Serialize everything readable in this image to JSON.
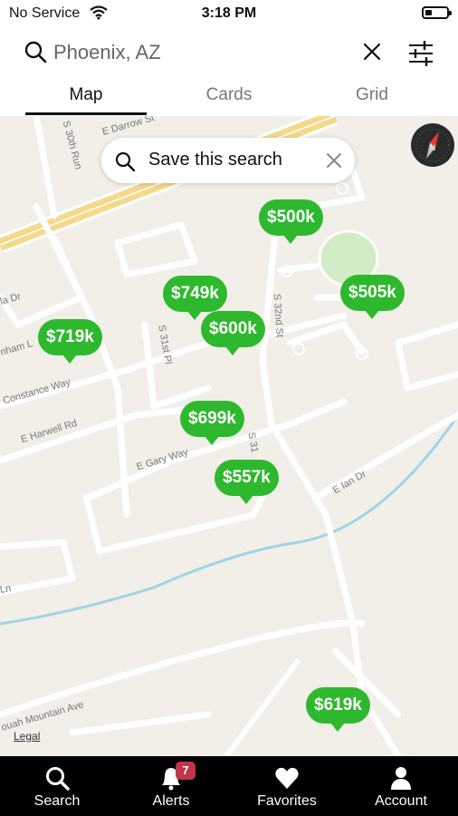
{
  "status_bar": {
    "carrier": "No Service",
    "time": "3:18 PM"
  },
  "search": {
    "query": "Phoenix, AZ"
  },
  "tabs": [
    {
      "label": "Map",
      "active": true
    },
    {
      "label": "Cards",
      "active": false
    },
    {
      "label": "Grid",
      "active": false
    }
  ],
  "map": {
    "save_search_label": "Save this search",
    "legal_label": "Legal",
    "road_labels": [
      "E Darrow St",
      "S 30th Run",
      "S 32nd St",
      "S 31st Pl",
      "Constance Way",
      "E Harwell Rd",
      "E Gary Way",
      "E Ian Dr",
      "S 31",
      "ouah Mountain Ave",
      "Ln",
      "nham L",
      "la Dr"
    ],
    "price_pins": [
      "$500k",
      "$749k",
      "$505k",
      "$600k",
      "$719k",
      "$699k",
      "$557k",
      "$619k"
    ],
    "colors": {
      "pin": "#2eb82e",
      "land": "#f1efe8",
      "park": "#d3ecc8",
      "highway": "#f5d98b",
      "water": "#9fd4e6"
    }
  },
  "bottom_nav": {
    "items": [
      {
        "label": "Search",
        "icon": "search-icon",
        "active": true
      },
      {
        "label": "Alerts",
        "icon": "bell-icon",
        "badge": "7"
      },
      {
        "label": "Favorites",
        "icon": "heart-icon"
      },
      {
        "label": "Account",
        "icon": "person-icon"
      }
    ]
  }
}
